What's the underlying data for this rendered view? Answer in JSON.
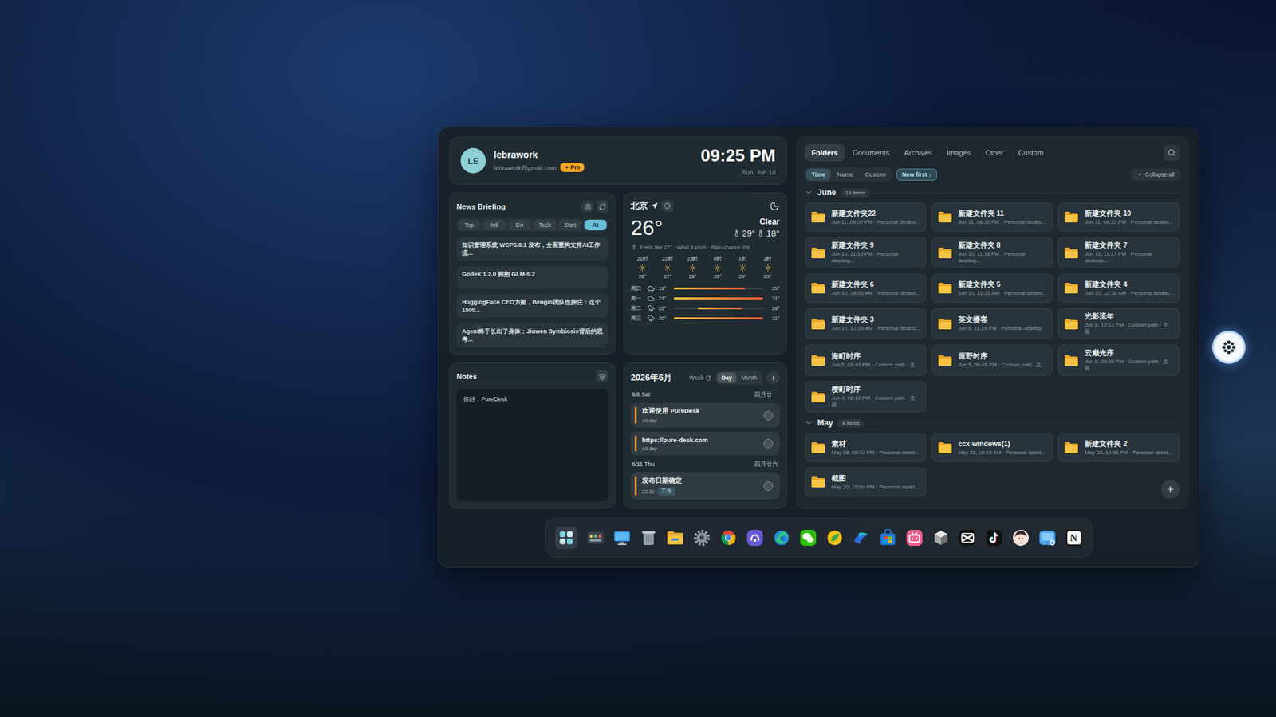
{
  "profile": {
    "initials": "LE",
    "name": "lebrawork",
    "email": "lebrawork@gmail.com",
    "badge": "✦ Pro"
  },
  "clock": {
    "time": "09:25 PM",
    "date": "Sun, Jun 14"
  },
  "news": {
    "title": "News Briefing",
    "tabs": [
      {
        "label": "Top",
        "selected": false
      },
      {
        "label": "Intl",
        "selected": false
      },
      {
        "label": "Biz",
        "selected": false
      },
      {
        "label": "Tech",
        "selected": false
      },
      {
        "label": "Start",
        "selected": false
      },
      {
        "label": "AI",
        "selected": true
      }
    ],
    "items": [
      "知识管理系统 WCP5.0.1 发布，全面重构支持AI工作流...",
      "GodeX 1.2.0 拥抱 GLM-5.2",
      "HuggingFace CEO力挺，Bengio团队也押注：这个1500...",
      "Agent终于长出了身体：Jiuwen Symbiosis背后的思考..."
    ]
  },
  "notes": {
    "title": "Notes",
    "text": "你好，PureDesk"
  },
  "weather": {
    "city": "北京",
    "temp": "26°",
    "condition": "Clear",
    "high": "29°",
    "low": "18°",
    "details": "Feels like 27° · Wind 8 km/h · Rain chance 0%",
    "hourly": [
      {
        "time": "21时",
        "temp": "26°"
      },
      {
        "time": "22时",
        "temp": "27°"
      },
      {
        "time": "23时",
        "temp": "28°"
      },
      {
        "time": "0时",
        "temp": "29°"
      },
      {
        "time": "1时",
        "temp": "29°"
      },
      {
        "time": "2时",
        "temp": "29°"
      }
    ],
    "daily": [
      {
        "day": "周日",
        "kind": "cloudy",
        "low": "18°",
        "high": "29°",
        "start": 0,
        "level": 0.8
      },
      {
        "day": "周一",
        "kind": "cloudy",
        "low": "21°",
        "high": "31°",
        "start": 0,
        "level": 1
      },
      {
        "day": "周二",
        "kind": "rain",
        "low": "22°",
        "high": "28°",
        "start": 0.27,
        "level": 0.5
      },
      {
        "day": "周三",
        "kind": "rain",
        "low": "20°",
        "high": "31°",
        "start": 0,
        "level": 1
      }
    ]
  },
  "calendar": {
    "title": "2026年6月",
    "toggle": "Week",
    "modes": [
      {
        "label": "Day",
        "selected": true
      },
      {
        "label": "Month",
        "selected": false
      }
    ],
    "days": [
      {
        "date": "6/6 Sat",
        "lunar": "四月廿一",
        "events": [
          {
            "title": "欢迎使用 PureDesk",
            "time": "All day",
            "tag": "",
            "done": false,
            "color": "#e8913a"
          },
          {
            "title": "https://pure-desk.com",
            "time": "All day",
            "tag": "",
            "done": false,
            "color": "#e8913a"
          }
        ]
      },
      {
        "date": "6/11 Thu",
        "lunar": "四月廿六",
        "events": [
          {
            "title": "发布日期确定",
            "time": "22:30",
            "tag": "工作",
            "done": false,
            "color": "#e8913a"
          }
        ]
      }
    ]
  },
  "files": {
    "tabs": [
      {
        "label": "Folders",
        "selected": true
      },
      {
        "label": "Documents",
        "selected": false
      },
      {
        "label": "Archives",
        "selected": false
      },
      {
        "label": "Images",
        "selected": false
      },
      {
        "label": "Other",
        "selected": false
      },
      {
        "label": "Custom",
        "selected": false
      }
    ],
    "sort": [
      {
        "label": "Time",
        "selected": true
      },
      {
        "label": "Name",
        "selected": false
      },
      {
        "label": "Custom",
        "selected": false
      }
    ],
    "order": {
      "label": "New first ↓",
      "selected": true
    },
    "collapse": "Collapse all",
    "groups": [
      {
        "name": "June",
        "count": "16 items",
        "expanded": true,
        "folders": [
          {
            "name": "新建文件夹22",
            "meta": "Jun 11, 09:07 PM · Personal deskto..."
          },
          {
            "name": "新建文件夹 11",
            "meta": "Jun 11, 08:35 PM · Personal deskto..."
          },
          {
            "name": "新建文件夹 10",
            "meta": "Jun 11, 08:35 PM · Personal deskto..."
          },
          {
            "name": "新建文件夹 9",
            "meta": "Jun 10, 11:19 PM · Personal desktop..."
          },
          {
            "name": "新建文件夹 8",
            "meta": "Jun 10, 11:18 PM · Personal desktop..."
          },
          {
            "name": "新建文件夹 7",
            "meta": "Jun 10, 11:17 PM · Personal desktop..."
          },
          {
            "name": "新建文件夹 6",
            "meta": "Jun 10, 08:55 AM · Personal deskto..."
          },
          {
            "name": "新建文件夹 5",
            "meta": "Jun 10, 12:31 AM · Personal deskto..."
          },
          {
            "name": "新建文件夹 4",
            "meta": "Jun 10, 12:30 AM · Personal deskto..."
          },
          {
            "name": "新建文件夹 3",
            "meta": "Jun 10, 12:29 AM · Personal deskto..."
          },
          {
            "name": "英文播客",
            "meta": "Jun 9, 11:29 PM · Personal desktop"
          },
          {
            "name": "光影流年",
            "meta": "Jun 6, 12:12 PM · Custom path · 主题"
          },
          {
            "name": "海町时序",
            "meta": "Jun 5, 09:49 PM · Custom path · 主..."
          },
          {
            "name": "原野时序",
            "meta": "Jun 5, 09:45 PM · Custom path · 主..."
          },
          {
            "name": "云巅光序",
            "meta": "Jun 5, 09:38 PM · Custom path · 主题"
          },
          {
            "name": "樱町时序",
            "meta": "Jun 4, 06:19 PM · Custom path · 主题"
          }
        ]
      },
      {
        "name": "May",
        "count": "4 items",
        "expanded": true,
        "folders": [
          {
            "name": "素材",
            "meta": "May 28, 09:32 PM · Personal deskt..."
          },
          {
            "name": "ccx-windows(1)",
            "meta": "May 23, 10:19 AM · Personal deskt..."
          },
          {
            "name": "新建文件夹 2",
            "meta": "May 22, 10:36 PM · Personal deskt..."
          },
          {
            "name": "截图",
            "meta": "May 20, 10:59 PM · Personal deskt..."
          }
        ]
      }
    ]
  },
  "dock": [
    {
      "kind": "launcher",
      "glyph": ""
    },
    {
      "kind": "widgets",
      "glyph": ""
    },
    {
      "kind": "monitor",
      "glyph": ""
    },
    {
      "kind": "recycle",
      "glyph": ""
    },
    {
      "kind": "explorer",
      "glyph": ""
    },
    {
      "kind": "settings",
      "glyph": ""
    },
    {
      "kind": "chrome",
      "glyph": ""
    },
    {
      "kind": "assistant",
      "glyph": ""
    },
    {
      "kind": "edge",
      "glyph": ""
    },
    {
      "kind": "wechat",
      "glyph": ""
    },
    {
      "kind": "leaf",
      "glyph": ""
    },
    {
      "kind": "wave",
      "glyph": ""
    },
    {
      "kind": "store",
      "glyph": ""
    },
    {
      "kind": "bilibili",
      "glyph": ""
    },
    {
      "kind": "cube",
      "glyph": ""
    },
    {
      "kind": "capcut",
      "glyph": ""
    },
    {
      "kind": "tiktok",
      "glyph": ""
    },
    {
      "kind": "avatar",
      "glyph": ""
    },
    {
      "kind": "blueapp",
      "glyph": ""
    },
    {
      "kind": "notion",
      "glyph": "N"
    }
  ]
}
